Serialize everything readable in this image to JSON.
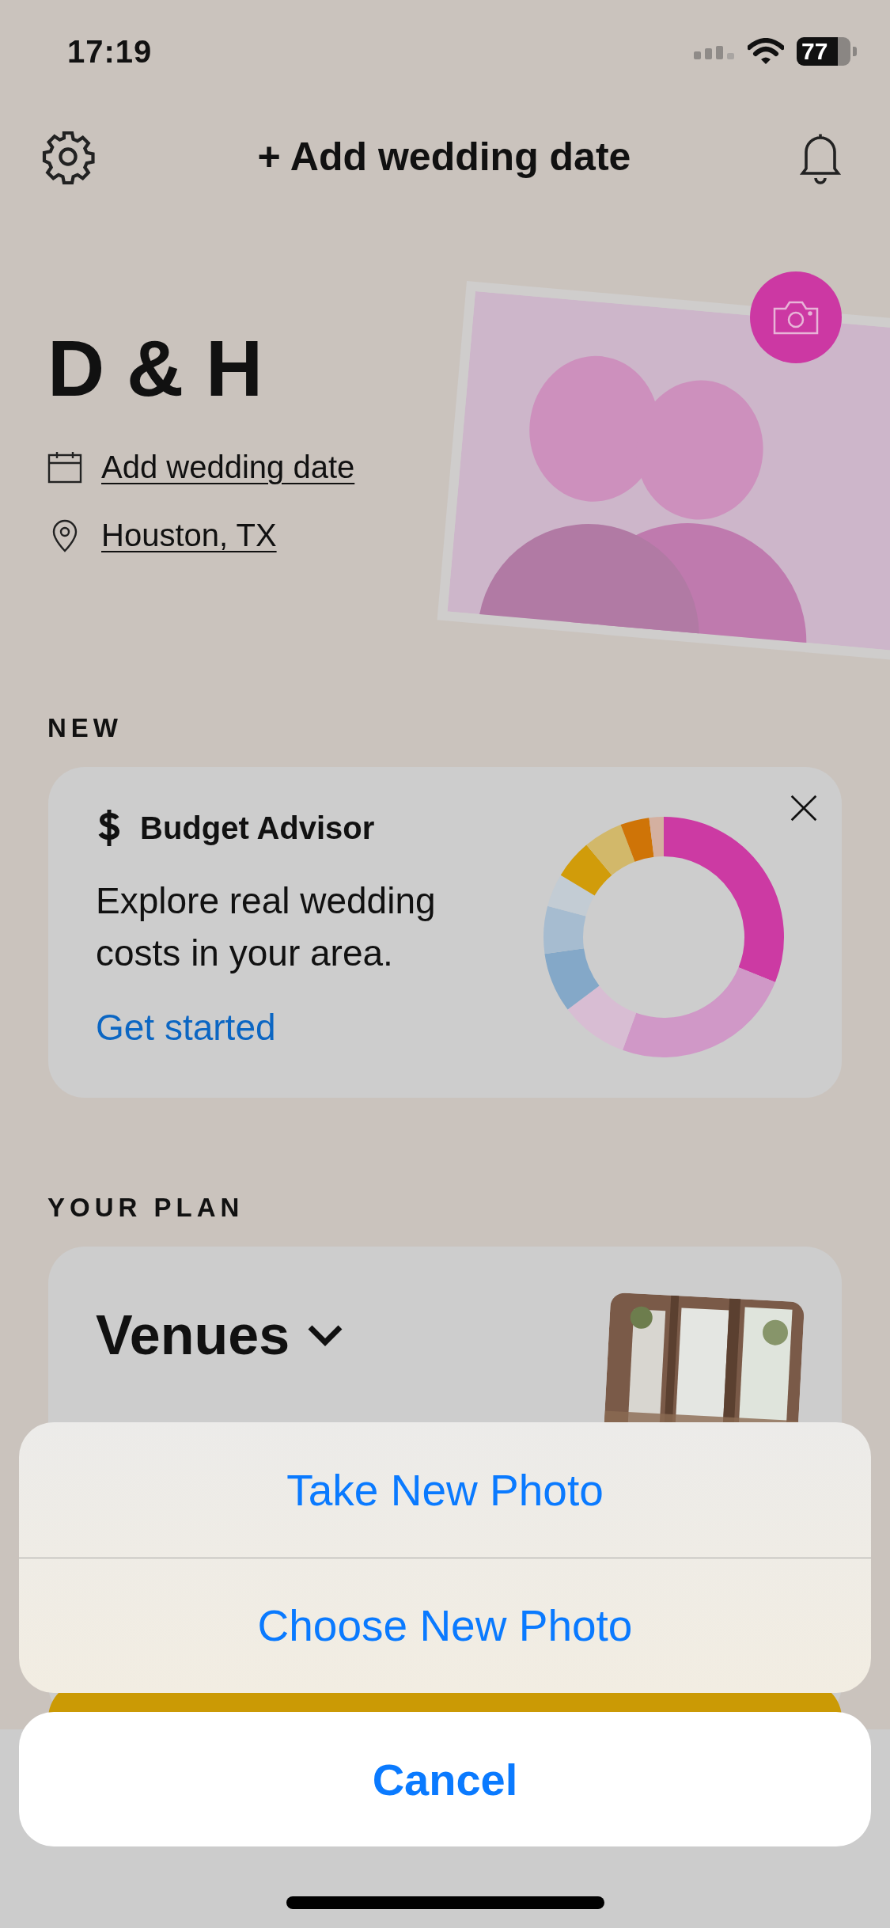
{
  "status_bar": {
    "time": "17:19",
    "battery": "77"
  },
  "header": {
    "title": "+ Add wedding date"
  },
  "couple": {
    "names": "D & H",
    "date_link": "Add wedding date",
    "location_link": "Houston, TX"
  },
  "new_section": {
    "heading": "NEW",
    "card": {
      "title": "Budget Advisor",
      "body": "Explore real wedding costs in your area.",
      "link": "Get started"
    }
  },
  "plan_section": {
    "heading": "YOUR PLAN",
    "card": {
      "title": "Venues"
    }
  },
  "action_sheet": {
    "actions": [
      "Take New Photo",
      "Choose New Photo"
    ],
    "cancel": "Cancel"
  }
}
